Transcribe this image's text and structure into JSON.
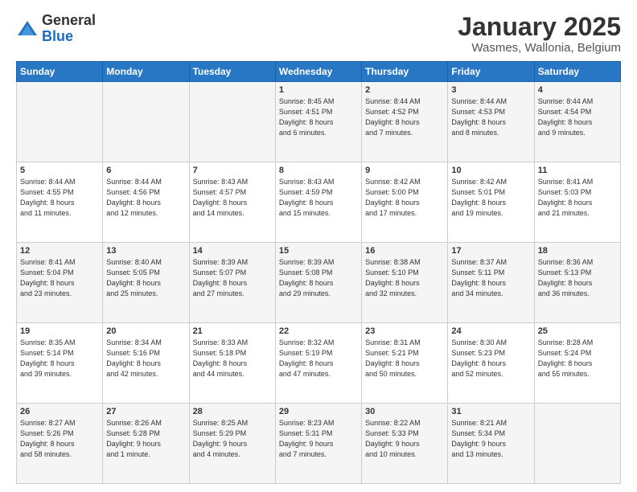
{
  "header": {
    "logo_general": "General",
    "logo_blue": "Blue",
    "month_title": "January 2025",
    "location": "Wasmes, Wallonia, Belgium"
  },
  "weekdays": [
    "Sunday",
    "Monday",
    "Tuesday",
    "Wednesday",
    "Thursday",
    "Friday",
    "Saturday"
  ],
  "weeks": [
    [
      {
        "day": "",
        "info": ""
      },
      {
        "day": "",
        "info": ""
      },
      {
        "day": "",
        "info": ""
      },
      {
        "day": "1",
        "info": "Sunrise: 8:45 AM\nSunset: 4:51 PM\nDaylight: 8 hours\nand 6 minutes."
      },
      {
        "day": "2",
        "info": "Sunrise: 8:44 AM\nSunset: 4:52 PM\nDaylight: 8 hours\nand 7 minutes."
      },
      {
        "day": "3",
        "info": "Sunrise: 8:44 AM\nSunset: 4:53 PM\nDaylight: 8 hours\nand 8 minutes."
      },
      {
        "day": "4",
        "info": "Sunrise: 8:44 AM\nSunset: 4:54 PM\nDaylight: 8 hours\nand 9 minutes."
      }
    ],
    [
      {
        "day": "5",
        "info": "Sunrise: 8:44 AM\nSunset: 4:55 PM\nDaylight: 8 hours\nand 11 minutes."
      },
      {
        "day": "6",
        "info": "Sunrise: 8:44 AM\nSunset: 4:56 PM\nDaylight: 8 hours\nand 12 minutes."
      },
      {
        "day": "7",
        "info": "Sunrise: 8:43 AM\nSunset: 4:57 PM\nDaylight: 8 hours\nand 14 minutes."
      },
      {
        "day": "8",
        "info": "Sunrise: 8:43 AM\nSunset: 4:59 PM\nDaylight: 8 hours\nand 15 minutes."
      },
      {
        "day": "9",
        "info": "Sunrise: 8:42 AM\nSunset: 5:00 PM\nDaylight: 8 hours\nand 17 minutes."
      },
      {
        "day": "10",
        "info": "Sunrise: 8:42 AM\nSunset: 5:01 PM\nDaylight: 8 hours\nand 19 minutes."
      },
      {
        "day": "11",
        "info": "Sunrise: 8:41 AM\nSunset: 5:03 PM\nDaylight: 8 hours\nand 21 minutes."
      }
    ],
    [
      {
        "day": "12",
        "info": "Sunrise: 8:41 AM\nSunset: 5:04 PM\nDaylight: 8 hours\nand 23 minutes."
      },
      {
        "day": "13",
        "info": "Sunrise: 8:40 AM\nSunset: 5:05 PM\nDaylight: 8 hours\nand 25 minutes."
      },
      {
        "day": "14",
        "info": "Sunrise: 8:39 AM\nSunset: 5:07 PM\nDaylight: 8 hours\nand 27 minutes."
      },
      {
        "day": "15",
        "info": "Sunrise: 8:39 AM\nSunset: 5:08 PM\nDaylight: 8 hours\nand 29 minutes."
      },
      {
        "day": "16",
        "info": "Sunrise: 8:38 AM\nSunset: 5:10 PM\nDaylight: 8 hours\nand 32 minutes."
      },
      {
        "day": "17",
        "info": "Sunrise: 8:37 AM\nSunset: 5:11 PM\nDaylight: 8 hours\nand 34 minutes."
      },
      {
        "day": "18",
        "info": "Sunrise: 8:36 AM\nSunset: 5:13 PM\nDaylight: 8 hours\nand 36 minutes."
      }
    ],
    [
      {
        "day": "19",
        "info": "Sunrise: 8:35 AM\nSunset: 5:14 PM\nDaylight: 8 hours\nand 39 minutes."
      },
      {
        "day": "20",
        "info": "Sunrise: 8:34 AM\nSunset: 5:16 PM\nDaylight: 8 hours\nand 42 minutes."
      },
      {
        "day": "21",
        "info": "Sunrise: 8:33 AM\nSunset: 5:18 PM\nDaylight: 8 hours\nand 44 minutes."
      },
      {
        "day": "22",
        "info": "Sunrise: 8:32 AM\nSunset: 5:19 PM\nDaylight: 8 hours\nand 47 minutes."
      },
      {
        "day": "23",
        "info": "Sunrise: 8:31 AM\nSunset: 5:21 PM\nDaylight: 8 hours\nand 50 minutes."
      },
      {
        "day": "24",
        "info": "Sunrise: 8:30 AM\nSunset: 5:23 PM\nDaylight: 8 hours\nand 52 minutes."
      },
      {
        "day": "25",
        "info": "Sunrise: 8:28 AM\nSunset: 5:24 PM\nDaylight: 8 hours\nand 55 minutes."
      }
    ],
    [
      {
        "day": "26",
        "info": "Sunrise: 8:27 AM\nSunset: 5:26 PM\nDaylight: 8 hours\nand 58 minutes."
      },
      {
        "day": "27",
        "info": "Sunrise: 8:26 AM\nSunset: 5:28 PM\nDaylight: 9 hours\nand 1 minute."
      },
      {
        "day": "28",
        "info": "Sunrise: 8:25 AM\nSunset: 5:29 PM\nDaylight: 9 hours\nand 4 minutes."
      },
      {
        "day": "29",
        "info": "Sunrise: 8:23 AM\nSunset: 5:31 PM\nDaylight: 9 hours\nand 7 minutes."
      },
      {
        "day": "30",
        "info": "Sunrise: 8:22 AM\nSunset: 5:33 PM\nDaylight: 9 hours\nand 10 minutes."
      },
      {
        "day": "31",
        "info": "Sunrise: 8:21 AM\nSunset: 5:34 PM\nDaylight: 9 hours\nand 13 minutes."
      },
      {
        "day": "",
        "info": ""
      }
    ]
  ]
}
